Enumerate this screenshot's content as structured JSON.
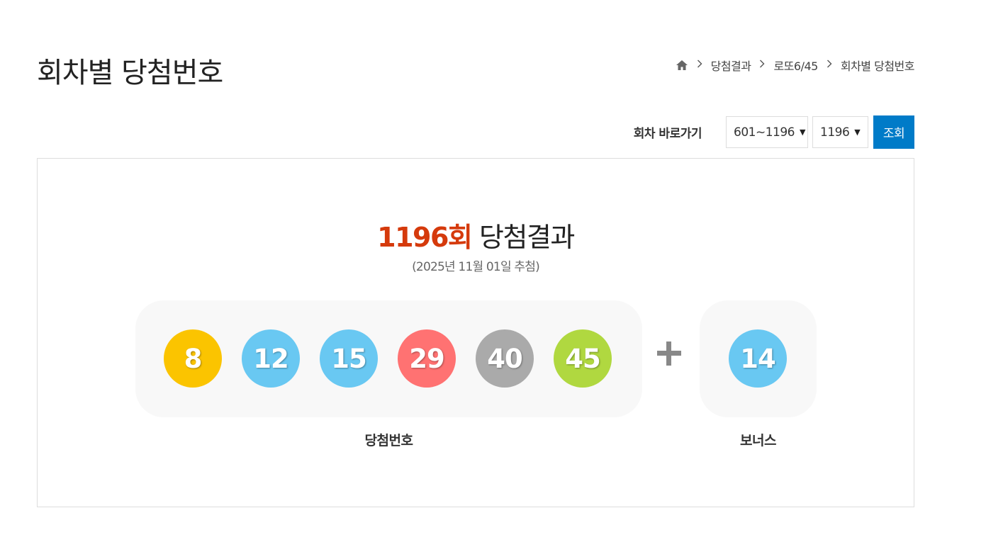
{
  "page": {
    "title": "회차별 당첨번호"
  },
  "breadcrumb": {
    "home_icon": "home-icon",
    "items": [
      "당첨결과",
      "로또6/45",
      "회차별 당첨번호"
    ]
  },
  "toolbar": {
    "label": "회차 바로가기",
    "range_select": "601~1196",
    "round_select": "1196",
    "search_button": "조회"
  },
  "result": {
    "round": "1196회",
    "title_suffix": "당첨결과",
    "draw_date": "(2025년 11월 01일 추첨)",
    "winning_label": "당첨번호",
    "bonus_label": "보너스",
    "winning_numbers": [
      {
        "number": "8",
        "color": "#fbc400"
      },
      {
        "number": "12",
        "color": "#69c8f2"
      },
      {
        "number": "15",
        "color": "#69c8f2"
      },
      {
        "number": "29",
        "color": "#ff7272"
      },
      {
        "number": "40",
        "color": "#aaaaaa"
      },
      {
        "number": "45",
        "color": "#b0d840"
      }
    ],
    "bonus_number": {
      "number": "14",
      "color": "#69c8f2"
    }
  },
  "colors": {
    "accent_round": "#d53a0c",
    "button_blue": "#007bc8"
  }
}
